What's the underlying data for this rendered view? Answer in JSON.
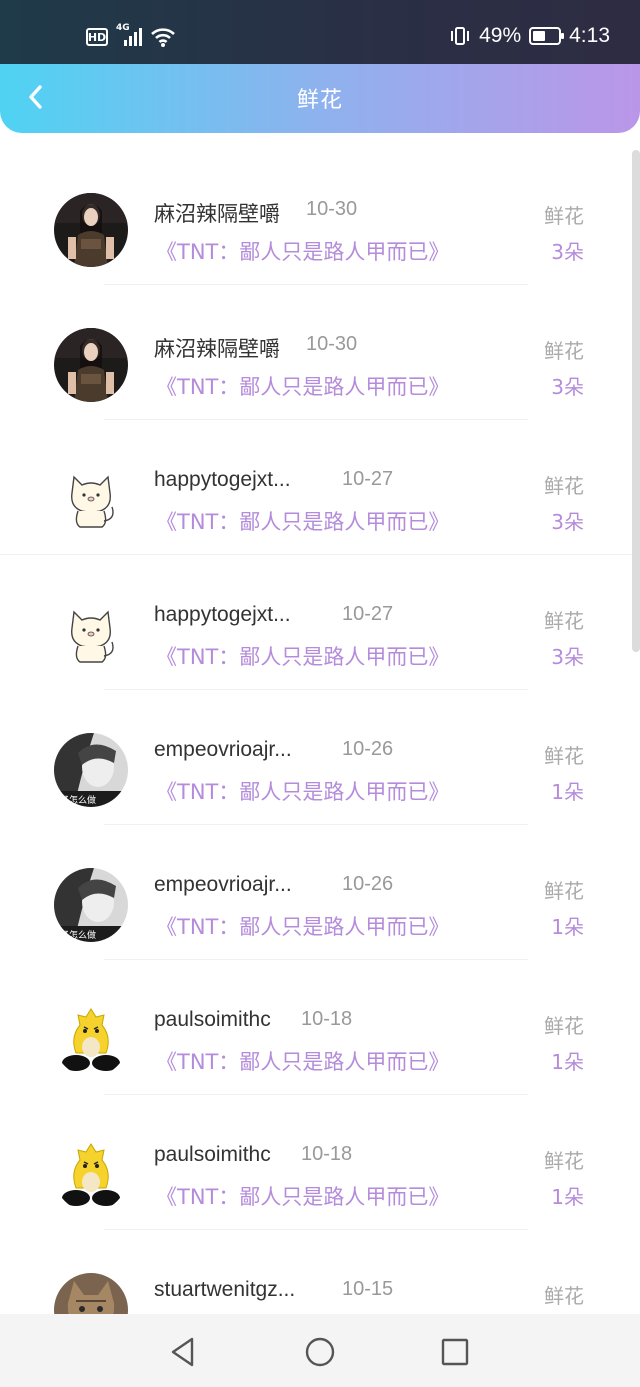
{
  "status_bar": {
    "hd": "HD",
    "net": "4G",
    "battery_percent": "49%",
    "battery_level": 0.49,
    "time": "4:13"
  },
  "header": {
    "title": "鲜花"
  },
  "list": {
    "items": [
      {
        "username": "麻沼辣隔壁嚼",
        "date": "10-30",
        "title": "《TNT：鄙人只是路人甲而已》",
        "label": "鲜花",
        "count": "3朵",
        "avatar": "girl-avatar"
      },
      {
        "username": "麻沼辣隔壁嚼",
        "date": "10-30",
        "title": "《TNT：鄙人只是路人甲而已》",
        "label": "鲜花",
        "count": "3朵",
        "avatar": "girl-avatar"
      },
      {
        "username": "happytogejxt...",
        "date": "10-27",
        "title": "《TNT：鄙人只是路人甲而已》",
        "label": "鲜花",
        "count": "3朵",
        "avatar": "cat-avatar"
      },
      {
        "username": "happytogejxt...",
        "date": "10-27",
        "title": "《TNT：鄙人只是路人甲而已》",
        "label": "鲜花",
        "count": "3朵",
        "avatar": "cat-avatar"
      },
      {
        "username": "empeovrioajr...",
        "date": "10-26",
        "title": "《TNT：鄙人只是路人甲而已》",
        "label": "鲜花",
        "count": "1朵",
        "avatar": "bw-girl-avatar"
      },
      {
        "username": "empeovrioajr...",
        "date": "10-26",
        "title": "《TNT：鄙人只是路人甲而已》",
        "label": "鲜花",
        "count": "1朵",
        "avatar": "bw-girl-avatar"
      },
      {
        "username": "paulsoimithc",
        "date": "10-18",
        "title": "《TNT：鄙人只是路人甲而已》",
        "label": "鲜花",
        "count": "1朵",
        "avatar": "yellow-bird-avatar"
      },
      {
        "username": "paulsoimithc",
        "date": "10-18",
        "title": "《TNT：鄙人只是路人甲而已》",
        "label": "鲜花",
        "count": "1朵",
        "avatar": "yellow-bird-avatar"
      },
      {
        "username": "stuartwenitgz...",
        "date": "10-15",
        "title": "",
        "label": "鲜花",
        "count": "",
        "avatar": "kitten-avatar"
      }
    ]
  },
  "nav": {
    "back": "back-triangle-icon",
    "home": "home-circle-icon",
    "recents": "recents-square-icon"
  },
  "colors": {
    "accent": "#b58cdb",
    "header_start": "#4fd3f2",
    "header_end": "#bb96e8"
  }
}
